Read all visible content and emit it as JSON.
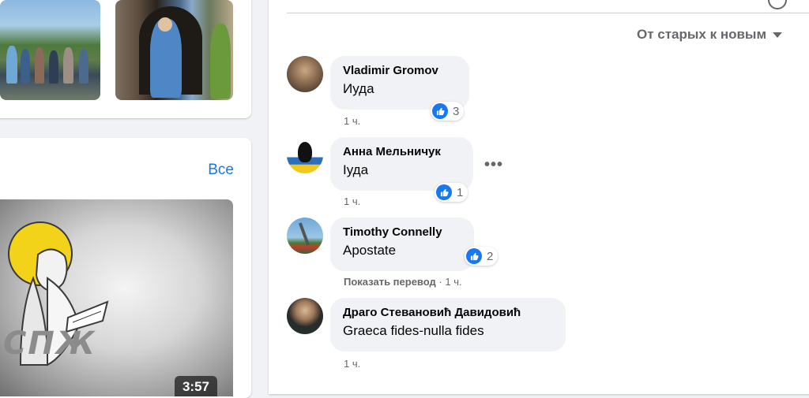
{
  "videos": {
    "see_all": "Все",
    "duration": "3:57",
    "logo_text": "СПЖ"
  },
  "comments_section": {
    "sort_label": "От старых к новым",
    "comments": [
      {
        "author": "Vladimir Gromov",
        "text": "Иуда",
        "likes": "3",
        "time": "1 ч."
      },
      {
        "author": "Анна Мельничук",
        "text": "Іуда",
        "likes": "1",
        "time": "1 ч."
      },
      {
        "author": "Timothy Connelly",
        "text": "Apostate",
        "likes": "2",
        "translate": "Показать перевод",
        "separator": "·",
        "time": "1 ч."
      },
      {
        "author": "Драго Стевановић Давидовић",
        "text": "Graeca fides-nulla fides",
        "time": "1 ч."
      }
    ],
    "more_options": "•••"
  },
  "colors": {
    "accent": "#1877f2",
    "background": "#f0f2f5",
    "secondary_text": "#65676b"
  },
  "icons": [
    "like-icon",
    "dropdown-caret-icon",
    "more-options-icon"
  ]
}
